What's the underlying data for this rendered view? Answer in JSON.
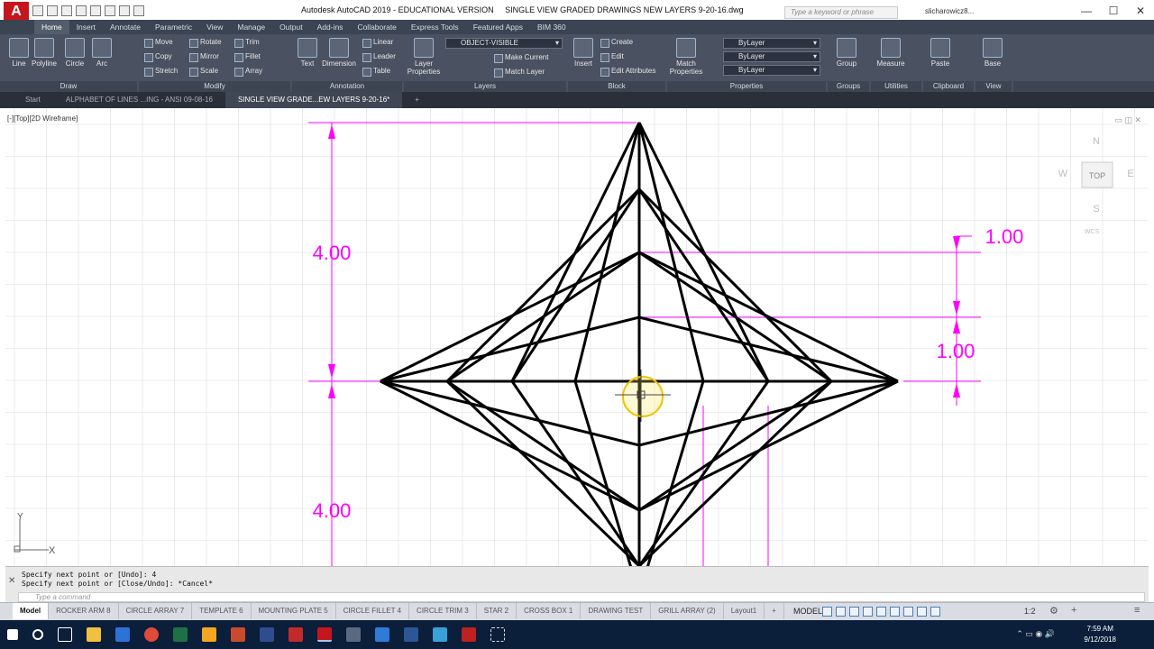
{
  "titlebar": {
    "app_title": "Autodesk AutoCAD 2019 - EDUCATIONAL VERSION",
    "file_title": "SINGLE VIEW GRADED DRAWINGS NEW LAYERS 9-20-16.dwg",
    "search_placeholder": "Type a keyword or phrase",
    "user": "slicharowicz8...",
    "logo": "A"
  },
  "ribbon_tabs": [
    "Home",
    "Insert",
    "Annotate",
    "Parametric",
    "View",
    "Manage",
    "Output",
    "Add-ins",
    "Collaborate",
    "Express Tools",
    "Featured Apps",
    "BIM 360"
  ],
  "panels": {
    "draw": {
      "footer": "Draw",
      "line": "Line",
      "polyline": "Polyline",
      "circle": "Circle",
      "arc": "Arc"
    },
    "modify": {
      "footer": "Modify",
      "move": "Move",
      "rotate": "Rotate",
      "trim": "Trim",
      "copy": "Copy",
      "mirror": "Mirror",
      "fillet": "Fillet",
      "stretch": "Stretch",
      "scale": "Scale",
      "array": "Array"
    },
    "annotation": {
      "footer": "Annotation",
      "text": "Text",
      "dimension": "Dimension",
      "linear": "Linear",
      "leader": "Leader",
      "table": "Table"
    },
    "layers": {
      "footer": "Layers",
      "layer_properties": "Layer Properties",
      "current_layer": "OBJECT-VISIBLE",
      "make_current": "Make Current",
      "match_layer": "Match Layer"
    },
    "block": {
      "footer": "Block",
      "insert": "Insert",
      "create": "Create",
      "edit": "Edit",
      "edit_attributes": "Edit Attributes"
    },
    "properties": {
      "footer": "Properties",
      "match_properties": "Match Properties",
      "color": "ByLayer",
      "linetype": "ByLayer",
      "lineweight": "ByLayer"
    },
    "groups": {
      "footer": "Groups",
      "group": "Group"
    },
    "utilities": {
      "footer": "Utilities",
      "measure": "Measure"
    },
    "clipboard": {
      "footer": "Clipboard",
      "paste": "Paste"
    },
    "view": {
      "footer": "View",
      "base": "Base"
    }
  },
  "file_tabs": [
    "Start",
    "ALPHABET OF LINES ...ING - ANSI 09-08-16",
    "SINGLE VIEW GRADE...EW LAYERS 9-20-16*"
  ],
  "viewport": {
    "label": "[-][Top][2D Wireframe]",
    "viewcube": {
      "north": "N",
      "south": "S",
      "east": "E",
      "west": "W",
      "top": "TOP",
      "wcs": "WCS"
    },
    "ucs": {
      "x": "X",
      "y": "Y"
    }
  },
  "drawing": {
    "dim_top_left": "4.00",
    "dim_bottom_left": "4.00",
    "dim_top_right": "1.00",
    "dim_mid_right": "1.00",
    "colors": {
      "object": "#000000",
      "dimension": "#ff00ff",
      "grid": "#d8dde6",
      "cursor": "#f2c200"
    }
  },
  "command": {
    "history": [
      "Specify next point or [Undo]: 4",
      "Specify next point or [Close/Undo]: *Cancel*"
    ],
    "placeholder": "Type a command"
  },
  "layout_tabs": [
    "Model",
    "ROCKER ARM 8",
    "CIRCLE ARRAY 7",
    "TEMPLATE 6",
    "MOUNTING PLATE 5",
    "CIRCLE FILLET 4",
    "CIRCLE TRIM 3",
    "STAR 2",
    "CROSS BOX 1",
    "DRAWING TEST",
    "GRILL ARRAY (2)",
    "Layout1"
  ],
  "status": {
    "model": "MODEL",
    "scale": "1:2"
  },
  "taskbar": {
    "time": "7:59 AM",
    "date": "9/12/2018"
  }
}
